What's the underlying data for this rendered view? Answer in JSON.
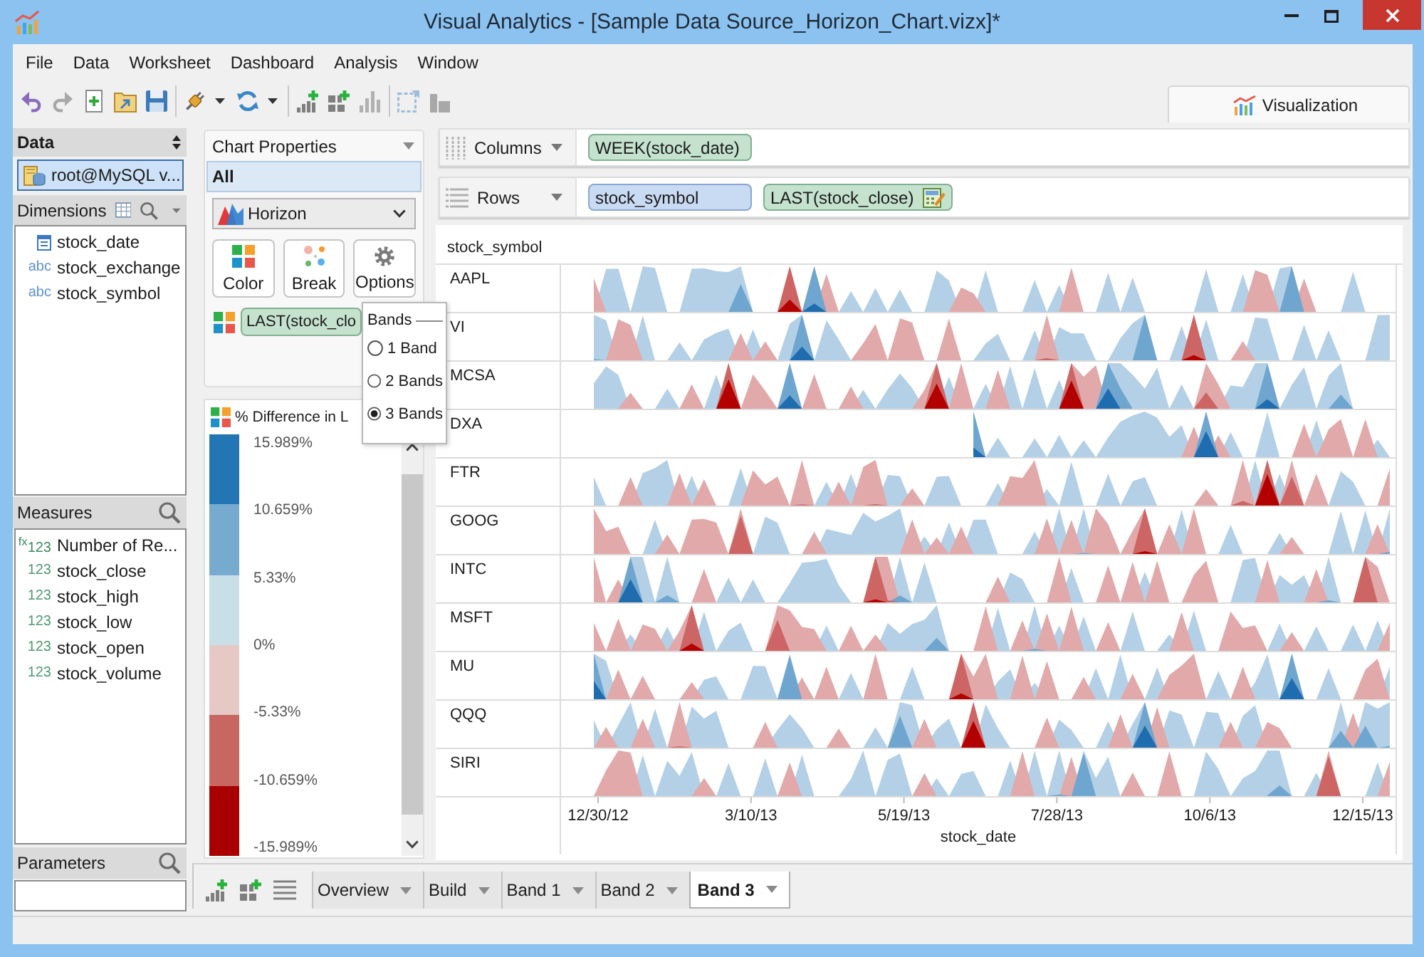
{
  "window": {
    "title": "Visual Analytics - [Sample Data Source_Horizon_Chart.vizx]*"
  },
  "menu": [
    "File",
    "Data",
    "Worksheet",
    "Dashboard",
    "Analysis",
    "Window"
  ],
  "toolbar_groups": [
    [
      {
        "kind": "undo",
        "disabled": false
      },
      {
        "kind": "redo",
        "disabled": true
      },
      {
        "kind": "new",
        "disabled": false
      },
      {
        "kind": "open",
        "disabled": false
      },
      {
        "kind": "save",
        "disabled": false
      }
    ],
    [
      {
        "kind": "connect",
        "disabled": false,
        "dropdown": true
      },
      {
        "kind": "refresh",
        "disabled": false,
        "dropdown": true
      }
    ],
    [
      {
        "kind": "add-chart",
        "disabled": false
      },
      {
        "kind": "add-dashboard",
        "disabled": false
      },
      {
        "kind": "chart",
        "disabled": true
      }
    ],
    [
      {
        "kind": "select",
        "disabled": true
      },
      {
        "kind": "stack",
        "disabled": true
      }
    ]
  ],
  "view_tabs": [
    {
      "label": "Visualization",
      "selected": true
    }
  ],
  "data_panel": {
    "title": "Data",
    "sources": [
      {
        "label": "root@MySQL v...",
        "selected": true
      }
    ]
  },
  "dimensions": {
    "title": "Dimensions",
    "fields": [
      {
        "name": "stock_date",
        "kind": "date"
      },
      {
        "name": "stock_exchange",
        "kind": "string",
        "type_label": "abc"
      },
      {
        "name": "stock_symbol",
        "kind": "string",
        "type_label": "abc"
      }
    ]
  },
  "measures": {
    "title": "Measures",
    "fields": [
      {
        "name": "Number of Re...",
        "kind": "calculated",
        "type_label": "$^{fx}$123"
      },
      {
        "name": "stock_close",
        "kind": "number",
        "type_label": "123"
      },
      {
        "name": "stock_high",
        "kind": "number",
        "type_label": "123"
      },
      {
        "name": "stock_low",
        "kind": "number",
        "type_label": "123"
      },
      {
        "name": "stock_open",
        "kind": "number",
        "type_label": "123"
      },
      {
        "name": "stock_volume",
        "kind": "number",
        "type_label": "123"
      }
    ]
  },
  "parameters": {
    "title": "Parameters"
  },
  "chart_properties": {
    "title": "Chart Properties",
    "scope": {
      "label": "All",
      "selected": true
    },
    "chart_type": "Horizon",
    "buttons": [
      {
        "label": "Color",
        "kind": "color"
      },
      {
        "label": "Break",
        "kind": "break"
      },
      {
        "label": "Options",
        "kind": "options"
      }
    ],
    "color_field": "LAST(stock_clo"
  },
  "bands_popup": {
    "title": "Bands",
    "options": [
      {
        "label": "1 Band",
        "selected": false
      },
      {
        "label": "2 Bands",
        "selected": false
      },
      {
        "label": "3 Bands",
        "selected": true
      }
    ]
  },
  "legend": {
    "title": "% Difference in L",
    "bands": [
      {
        "color": "#2176b3"
      },
      {
        "color": "#76abcf"
      },
      {
        "color": "#c9dfe7"
      },
      {
        "color": "#e6c9c4"
      },
      {
        "color": "#c86661"
      },
      {
        "color": "#a80000"
      }
    ],
    "ticks": [
      "15.989%",
      "10.659%",
      "5.33%",
      "0%",
      "-5.33%",
      "-10.659%",
      "-15.989%"
    ]
  },
  "shelves": [
    {
      "label": "Columns",
      "kind": "columns",
      "pills": [
        {
          "label": "WEEK(stock_date)",
          "kind": "continuous"
        }
      ]
    },
    {
      "label": "Rows",
      "kind": "rows",
      "pills": [
        {
          "label": "stock_symbol",
          "kind": "discrete"
        },
        {
          "label": "LAST(stock_close)",
          "kind": "continuous",
          "calc_icon": true
        }
      ]
    }
  ],
  "chart": {
    "row_header": "stock_symbol",
    "rows": [
      "AAPL",
      "VI",
      "MCSA",
      "DXA",
      "FTR",
      "GOOG",
      "INTC",
      "MSFT",
      "MU",
      "QQQ",
      "SIRI"
    ],
    "x_ticks": [
      "12/30/12",
      "3/10/13",
      "5/19/13",
      "7/28/13",
      "10/6/13",
      "12/15/13"
    ],
    "x_label": "stock_date"
  },
  "sheet_tabs": [
    {
      "label": "Overview",
      "selected": false
    },
    {
      "label": "Build",
      "selected": false
    },
    {
      "label": "Band 1",
      "selected": false
    },
    {
      "label": "Band 2",
      "selected": false
    },
    {
      "label": "Band 3",
      "selected": true
    }
  ]
}
